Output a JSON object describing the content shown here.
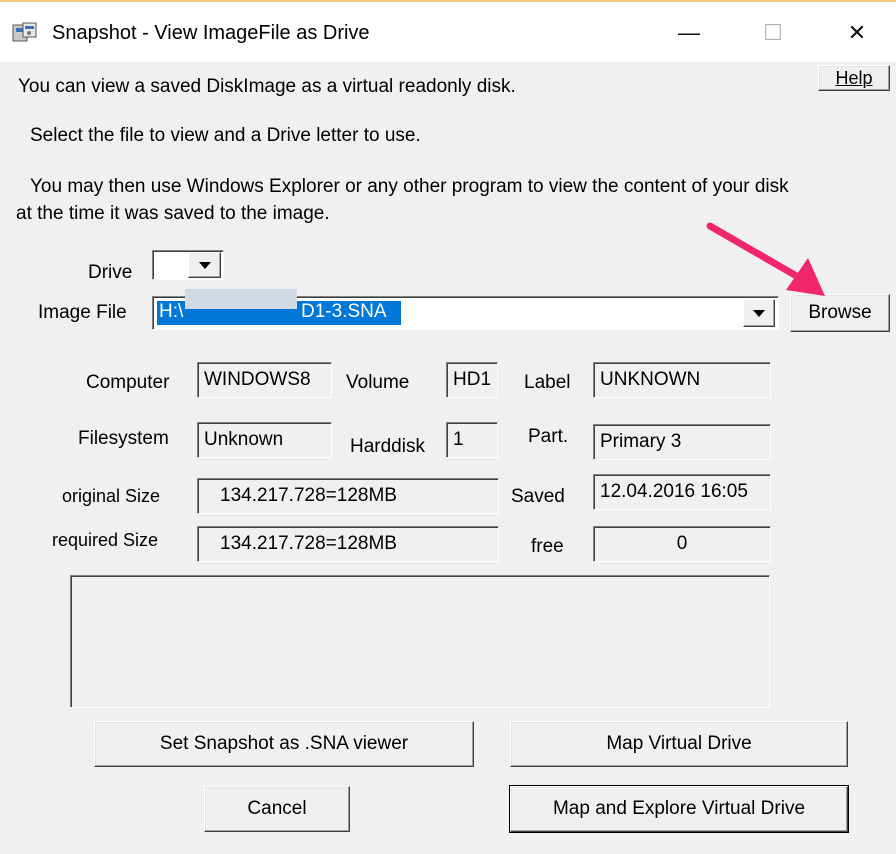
{
  "window": {
    "title": "Snapshot - View ImageFile as Drive",
    "minimize_glyph": "—",
    "maximize_glyph": "☐",
    "close_glyph": "✕"
  },
  "help_label": "Help",
  "intro": {
    "line1": "You can view a saved DiskImage as a virtual readonly disk.",
    "line2": "Select the file to view and a Drive letter to use.",
    "line3a": "You may then use Windows Explorer or any other program to view the content of your disk",
    "line3b": "at the time it was saved to the image."
  },
  "drive": {
    "label": "Drive",
    "value": ""
  },
  "image_file": {
    "label": "Image File",
    "value_start": "H:\\",
    "value_end": "D1-3.SNA"
  },
  "browse_label": "Browse",
  "info": {
    "computer_label": "Computer",
    "computer_value": "WINDOWS8",
    "volume_label": "Volume",
    "volume_value": "HD1",
    "label_label": "Label",
    "label_value": "UNKNOWN",
    "filesystem_label": "Filesystem",
    "filesystem_value": "Unknown",
    "harddisk_label": "Harddisk",
    "harddisk_value": "1",
    "part_label": "Part.",
    "part_value": "Primary 3",
    "orig_size_label": "original Size",
    "orig_size_value": "134.217.728=128MB",
    "saved_label": "Saved",
    "saved_value": "12.04.2016 16:05",
    "req_size_label": "required Size",
    "req_size_value": "134.217.728=128MB",
    "free_label": "free",
    "free_value": "0"
  },
  "buttons": {
    "set_viewer": "Set Snapshot as .SNA viewer",
    "map_drive": "Map Virtual Drive",
    "cancel": "Cancel",
    "map_explore": "Map and Explore Virtual Drive"
  },
  "colors": {
    "selection": "#0078d7",
    "redaction": "#cfd8e3",
    "arrow": "#f0286a",
    "dialog_bg": "#f0f0f0"
  }
}
